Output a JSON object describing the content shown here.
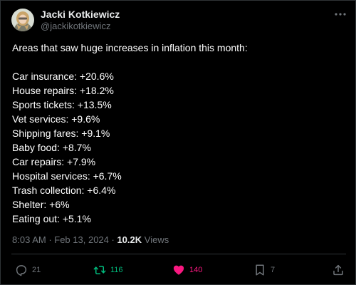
{
  "author": {
    "name": "Jacki Kotkiewicz",
    "handle": "@jackikotkiewicz"
  },
  "tweet": {
    "intro": "Areas that saw huge increases in inflation this month:",
    "items": [
      "Car insurance: +20.6%",
      "House repairs: +18.2%",
      "Sports tickets: +13.5%",
      "Vet services: +9.6%",
      "Shipping fares: +9.1%",
      "Baby food: +8.7%",
      "Car repairs: +7.9%",
      "Hospital services: +6.7%",
      "Trash collection: +6.4%",
      "Shelter: +6%",
      "Eating out: +5.1%"
    ]
  },
  "meta": {
    "time": "8:03 AM",
    "separator": " · ",
    "date": "Feb 13, 2024",
    "views_count": "10.2K",
    "views_label": " Views"
  },
  "actions": {
    "replies": "21",
    "reposts": "116",
    "likes": "140",
    "bookmarks": "7"
  },
  "icons": {
    "more": "more-options-icon",
    "reply": "reply-icon",
    "repost": "repost-icon",
    "like": "heart-icon",
    "bookmark": "bookmark-icon",
    "share": "share-icon"
  },
  "colors": {
    "background": "#000000",
    "text_primary": "#e7e9ea",
    "text_secondary": "#71767b",
    "repost_active": "#00ba7c",
    "like_active": "#f91880",
    "border": "#2f3336"
  }
}
